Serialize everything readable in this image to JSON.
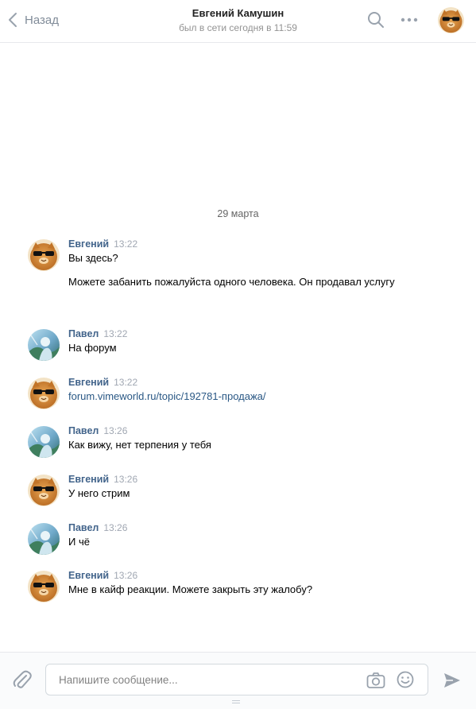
{
  "header": {
    "back_label": "Назад",
    "peer_name": "Евгений Камушин",
    "peer_status": "был в сети сегодня в 11:59"
  },
  "date_separator": "29 марта",
  "messages": [
    {
      "author": "Евгений",
      "time": "13:22",
      "lines": [
        "Вы здесь?",
        "Можете забанить пожалуйста одного человека. Он продавал услугу"
      ]
    },
    {
      "author": "Павел",
      "time": "13:22",
      "lines": [
        "На форум"
      ]
    },
    {
      "author": "Евгений",
      "time": "13:22",
      "link": "forum.vimeworld.ru/topic/192781-продажа/"
    },
    {
      "author": "Павел",
      "time": "13:26",
      "lines": [
        "Как вижу, нет терпения у тебя"
      ]
    },
    {
      "author": "Евгений",
      "time": "13:26",
      "lines": [
        "У него стрим"
      ]
    },
    {
      "author": "Павел",
      "time": "13:26",
      "lines": [
        "И чё"
      ]
    },
    {
      "author": "Евгений",
      "time": "13:26",
      "lines": [
        "Мне в кайф реакции. Можете закрыть эту жалобу?"
      ]
    }
  ],
  "composer": {
    "placeholder": "Напишите сообщение...",
    "value": ""
  },
  "icons": {
    "back": "chevron-left-icon",
    "search": "search-icon",
    "more": "more-horizontal-icon",
    "attach": "paperclip-icon",
    "camera": "camera-icon",
    "smile": "smile-icon",
    "send": "send-icon"
  },
  "colors": {
    "author": "#42648b",
    "link": "#2a5885",
    "icon": "#99a2ad",
    "border": "#e7e8ec"
  }
}
